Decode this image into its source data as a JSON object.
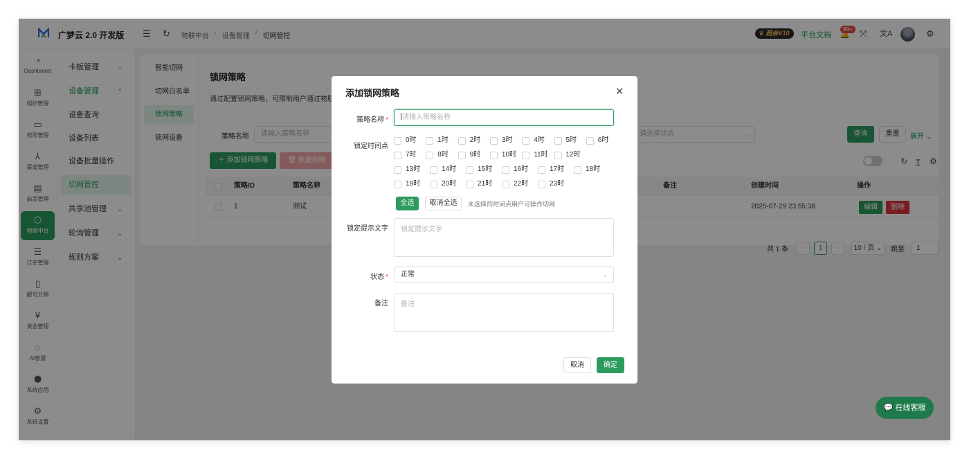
{
  "app": {
    "brand": "广梦云 2.0 开发版"
  },
  "header": {
    "breadcrumb": [
      "物联中台",
      "设备管理",
      "切网管控"
    ],
    "vip_label": "超会V10",
    "docs_link": "平台文档",
    "notice_badge": "99+"
  },
  "rail": [
    {
      "label": "Dashboard",
      "icon": "dashboard-icon"
    },
    {
      "label": "组织管理",
      "icon": "org-icon"
    },
    {
      "label": "权限管理",
      "icon": "monitor-icon"
    },
    {
      "label": "渠道管理",
      "icon": "channel-icon"
    },
    {
      "label": "商品管理",
      "icon": "shop-icon"
    },
    {
      "label": "物联中台",
      "icon": "iot-icon"
    },
    {
      "label": "订单管理",
      "icon": "list-icon"
    },
    {
      "label": "靓号分销",
      "icon": "phone-icon"
    },
    {
      "label": "资金管理",
      "icon": "money-icon"
    },
    {
      "label": "AI客服",
      "icon": "ai-icon"
    },
    {
      "label": "系统应用",
      "icon": "app-icon"
    },
    {
      "label": "系统设置",
      "icon": "settings-icon"
    }
  ],
  "submenu": {
    "items": [
      "卡板管理",
      "设备管理",
      "设备查询",
      "设备列表",
      "设备批量操作",
      "切网管控",
      "共享池管理",
      "轮询管理",
      "规则方案"
    ]
  },
  "tabs": [
    "智能切网",
    "切网白名单",
    "锁网策略",
    "锁网设备"
  ],
  "page": {
    "title": "锁网策略",
    "desc": "通过配置锁网策略，可限制用户通过物联",
    "filter_label": "策略名称",
    "filter_placeholder": "请输入策略名称",
    "status_placeholder": "请选择状态",
    "query": "查询",
    "reset": "重置",
    "expand": "展开",
    "add": "添加锁网策略",
    "batch_delete": "批量删除"
  },
  "table": {
    "headers": [
      "策略ID",
      "策略名称",
      "备注",
      "创建时间",
      "操作"
    ],
    "rows": [
      {
        "id": "1",
        "name": "测试",
        "remark": "",
        "created": "2025-07-29 23:55:38",
        "edit": "编辑",
        "delete": "删除"
      }
    ]
  },
  "pagination": {
    "total": "共 1 条",
    "page": "1",
    "size": "10 / 页",
    "jump_label": "跳至",
    "jump_value": "1"
  },
  "dialog": {
    "title": "添加锁网策略",
    "name_label": "策略名称",
    "name_placeholder": "请输入策略名称",
    "time_label": "锁定时间点",
    "hours": [
      "0时",
      "1时",
      "2时",
      "3时",
      "4时",
      "5时",
      "6时",
      "7时",
      "8时",
      "9时",
      "10时",
      "11时",
      "12时",
      "13时",
      "14时",
      "15时",
      "16时",
      "17时",
      "18时",
      "19时",
      "20时",
      "21时",
      "22时",
      "23时"
    ],
    "select_all": "全选",
    "cancel_all": "取消全选",
    "hint": "未选择的时间点用户可操作切网",
    "tip_label": "锁定提示文字",
    "tip_placeholder": "锁定提示文字",
    "status_label": "状态",
    "status_value": "正常",
    "remark_label": "备注",
    "remark_placeholder": "备注",
    "cancel": "取消",
    "confirm": "确定"
  },
  "chat": {
    "label": "在线客服"
  },
  "colors": {
    "primary": "#2d9b5f",
    "danger": "#d9363e"
  }
}
